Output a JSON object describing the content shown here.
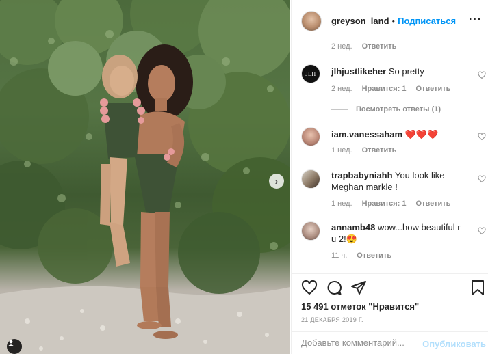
{
  "post": {
    "username": "greyson_land",
    "separator": "•",
    "follow_label": "Подписаться",
    "more_label": "···"
  },
  "comments": [
    {
      "username": "",
      "text": "",
      "age": "2 нед.",
      "likes": "",
      "reply_label": "Ответить"
    },
    {
      "username": "jlhjustlikeher",
      "text": "So pretty",
      "age": "2 нед.",
      "likes": "Нравится: 1",
      "reply_label": "Ответить",
      "avatar_text": "JLH"
    },
    {
      "username": "iam.vanessaham",
      "text": "❤️❤️❤️",
      "age": "1 нед.",
      "likes": "",
      "reply_label": "Ответить"
    },
    {
      "username": "trapbabyniahh",
      "text": "You look like Meghan markle !",
      "age": "1 нед.",
      "likes": "Нравится: 1",
      "reply_label": "Ответить"
    },
    {
      "username": "annamb48",
      "text": "wow...how beautiful r u 2!😍",
      "age": "11 ч.",
      "likes": "",
      "reply_label": "Ответить"
    }
  ],
  "view_replies_label": "Посмотреть ответы (1)",
  "likes_label": "15 491 отметок \"Нравится\"",
  "date_label": "21 ДЕКАБРЯ 2019 Г.",
  "add_comment": {
    "placeholder": "Добавьте комментарий...",
    "publish_label": "Опубликовать"
  },
  "colors": {
    "accent": "#0095f6",
    "publish_disabled": "#b2dffc",
    "heart_empty": "#8e8e8e",
    "secondary_text": "#8e8e8e"
  },
  "icons": [
    "heart-icon",
    "comment-icon",
    "share-icon",
    "bookmark-icon",
    "more-icon",
    "next-arrow-icon",
    "user-tag-icon"
  ]
}
